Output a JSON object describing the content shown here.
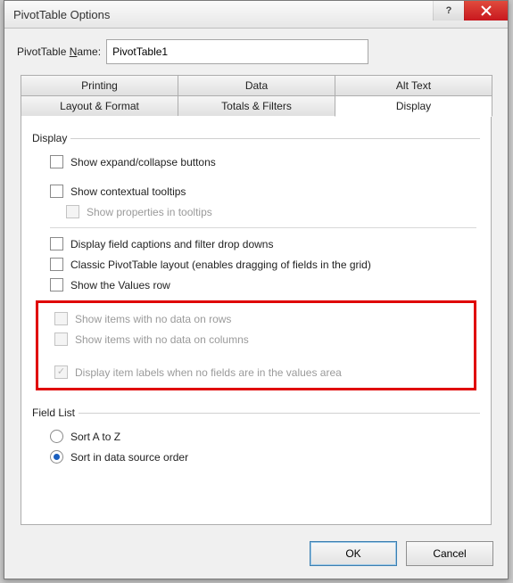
{
  "window": {
    "title": "PivotTable Options"
  },
  "nameRow": {
    "label_pre": "PivotTable ",
    "label_u": "N",
    "label_post": "ame:",
    "value": "PivotTable1"
  },
  "tabs": {
    "row1": [
      "Printing",
      "Data",
      "Alt Text"
    ],
    "row2": [
      "Layout & Format",
      "Totals & Filters",
      "Display"
    ],
    "active": "Display"
  },
  "display": {
    "legend": "Display",
    "expand": "Show expand/collapse buttons",
    "contextual": "Show contextual tooltips",
    "properties": "Show properties in tooltips",
    "captions": "Display field captions and filter drop downs",
    "classic": "Classic PivotTable layout (enables dragging of fields in the grid)",
    "valuesrow": "Show the Values row",
    "nodata_rows": "Show items with no data on rows",
    "nodata_cols": "Show items with no data on columns",
    "item_labels": "Display item labels when no fields are in the values area"
  },
  "fieldlist": {
    "legend": "Field List",
    "sort_az": "Sort A to Z",
    "sort_src": "Sort in data source order"
  },
  "buttons": {
    "ok": "OK",
    "cancel": "Cancel"
  }
}
